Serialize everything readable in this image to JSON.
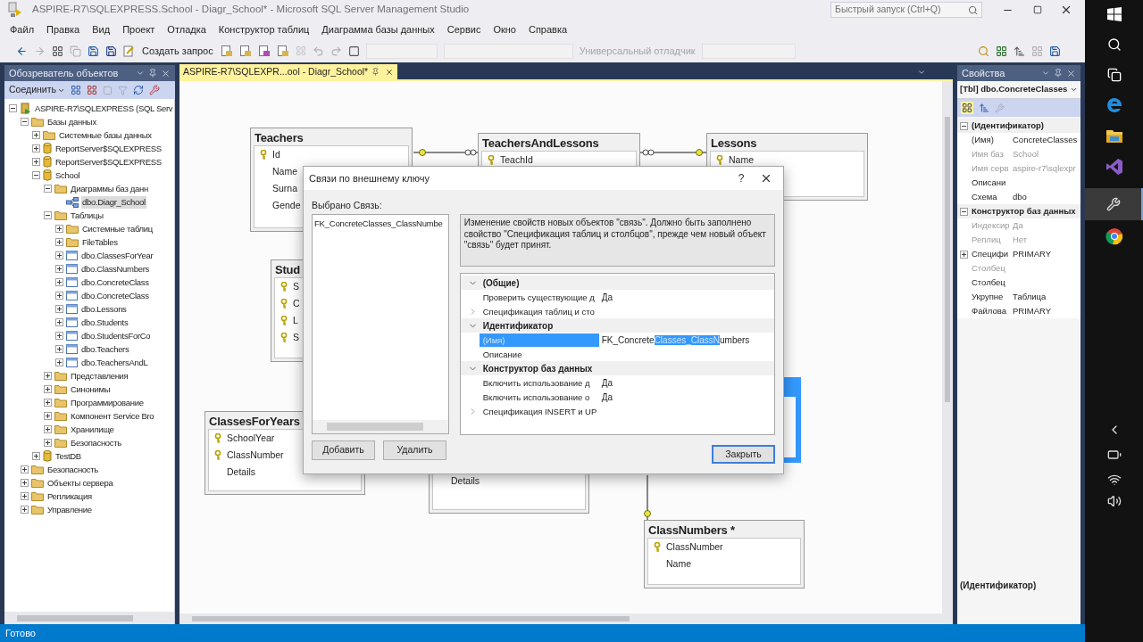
{
  "window": {
    "title": "ASPIRE-R7\\SQLEXPRESS.School - Diagr_School* - Microsoft SQL Server Management Studio"
  },
  "quick_launch": {
    "placeholder": "Быстрый запуск (Ctrl+Q)"
  },
  "menu": [
    "Файл",
    "Правка",
    "Вид",
    "Проект",
    "Отладка",
    "Конструктор таблиц",
    "Диаграмма базы данных",
    "Сервис",
    "Окно",
    "Справка"
  ],
  "toolbar": {
    "new_query": "Создать запрос",
    "debugger": "Универсальный отладчик"
  },
  "object_explorer": {
    "title": "Обозреватель объектов",
    "connect": "Соединить",
    "tree": [
      {
        "label": "ASPIRE-R7\\SQLEXPRESS (SQL Serv",
        "kind": "server",
        "expanded": true,
        "selected": false,
        "children": [
          {
            "label": "Базы данных",
            "kind": "folder",
            "expanded": true,
            "selected": false,
            "children": [
              {
                "label": "Системные базы данных",
                "kind": "folder",
                "expanded": false,
                "selected": false
              },
              {
                "label": "ReportServer$SQLEXPRESS",
                "kind": "database",
                "expanded": false,
                "selected": false
              },
              {
                "label": "ReportServer$SQLEXPRESS",
                "kind": "database",
                "expanded": false,
                "selected": false
              },
              {
                "label": "School",
                "kind": "database",
                "expanded": true,
                "selected": false,
                "children": [
                  {
                    "label": "Диаграммы баз данн",
                    "kind": "folder",
                    "expanded": true,
                    "selected": false,
                    "children": [
                      {
                        "label": "dbo.Diagr_School",
                        "kind": "diagram",
                        "selected": true
                      }
                    ]
                  },
                  {
                    "label": "Таблицы",
                    "kind": "folder",
                    "expanded": true,
                    "selected": false,
                    "children": [
                      {
                        "label": "Системные таблиц",
                        "kind": "folder",
                        "expanded": false,
                        "selected": false
                      },
                      {
                        "label": "FileTables",
                        "kind": "folder",
                        "expanded": false,
                        "selected": false
                      },
                      {
                        "label": "dbo.ClassesForYear",
                        "kind": "table",
                        "expanded": false,
                        "selected": false
                      },
                      {
                        "label": "dbo.ClassNumbers",
                        "kind": "table",
                        "expanded": false,
                        "selected": false
                      },
                      {
                        "label": "dbo.ConcreteClass",
                        "kind": "table",
                        "expanded": false,
                        "selected": false
                      },
                      {
                        "label": "dbo.ConcreteClass",
                        "kind": "table",
                        "expanded": false,
                        "selected": false
                      },
                      {
                        "label": "dbo.Lessons",
                        "kind": "table",
                        "expanded": false,
                        "selected": false
                      },
                      {
                        "label": "dbo.Students",
                        "kind": "table",
                        "expanded": false,
                        "selected": false
                      },
                      {
                        "label": "dbo.StudentsForCo",
                        "kind": "table",
                        "expanded": false,
                        "selected": false
                      },
                      {
                        "label": "dbo.Teachers",
                        "kind": "table",
                        "expanded": false,
                        "selected": false
                      },
                      {
                        "label": "dbo.TeachersAndL",
                        "kind": "table",
                        "expanded": false,
                        "selected": false
                      }
                    ]
                  },
                  {
                    "label": "Представления",
                    "kind": "folder",
                    "expanded": false,
                    "selected": false
                  },
                  {
                    "label": "Синонимы",
                    "kind": "folder",
                    "expanded": false,
                    "selected": false
                  },
                  {
                    "label": "Программирование",
                    "kind": "folder",
                    "expanded": false,
                    "selected": false
                  },
                  {
                    "label": "Компонент Service Bro",
                    "kind": "folder",
                    "expanded": false,
                    "selected": false
                  },
                  {
                    "label": "Хранилище",
                    "kind": "folder",
                    "expanded": false,
                    "selected": false
                  },
                  {
                    "label": "Безопасность",
                    "kind": "folder",
                    "expanded": false,
                    "selected": false
                  }
                ]
              },
              {
                "label": "TestDB",
                "kind": "database",
                "expanded": false,
                "selected": false
              }
            ]
          },
          {
            "label": "Безопасность",
            "kind": "folder",
            "expanded": false,
            "selected": false
          },
          {
            "label": "Объекты сервера",
            "kind": "folder",
            "expanded": false,
            "selected": false
          },
          {
            "label": "Репликация",
            "kind": "folder",
            "expanded": false,
            "selected": false
          },
          {
            "label": "Управление",
            "kind": "folder",
            "expanded": false,
            "selected": false
          }
        ]
      }
    ]
  },
  "document_tab": {
    "title": "ASPIRE-R7\\SQLEXPR...ool - Diagr_School*",
    "selected": true
  },
  "diagram": {
    "tables": [
      {
        "title": "Teachers",
        "selected": false,
        "columns": [
          {
            "name": "Id",
            "key": true
          },
          {
            "name": "Name",
            "key": false
          },
          {
            "name": "Surna",
            "key": false
          },
          {
            "name": "Gende",
            "key": false
          }
        ]
      },
      {
        "title": "TeachersAndLessons",
        "selected": false,
        "columns": [
          {
            "name": "TeachId",
            "key": true
          }
        ]
      },
      {
        "title": "Lessons",
        "selected": false,
        "columns": [
          {
            "name": "Name",
            "key": true
          }
        ]
      },
      {
        "title": "Stud",
        "selected": false,
        "columns": [
          {
            "name": "S",
            "key": true
          },
          {
            "name": "C",
            "key": true
          },
          {
            "name": "L",
            "key": true
          },
          {
            "name": "S",
            "key": true
          }
        ]
      },
      {
        "title": "ClassesForYears",
        "selected": false,
        "columns": [
          {
            "name": "SchoolYear",
            "key": true
          },
          {
            "name": "ClassNumber",
            "key": true
          },
          {
            "name": "Details",
            "key": false
          }
        ]
      },
      {
        "selected": false,
        "columns": [
          {
            "name": "Details",
            "key": false
          }
        ]
      },
      {
        "selected": true
      },
      {
        "title": "ClassNumbers *",
        "selected": false,
        "columns": [
          {
            "name": "ClassNumber",
            "key": true
          },
          {
            "name": "Name",
            "key": false
          }
        ]
      }
    ]
  },
  "properties": {
    "title": "Свойства",
    "object": "[Tbl] dbo.ConcreteClasses",
    "rows": [
      {
        "kind": "group",
        "name": "(Идентификатор)",
        "expanded": true
      },
      {
        "kind": "property",
        "name": "(Имя)",
        "value": "ConcreteClasses",
        "disabled": false
      },
      {
        "kind": "property",
        "name": "Имя баз",
        "value": "School",
        "disabled": true
      },
      {
        "kind": "property",
        "name": "Имя серв",
        "value": "aspire-r7\\sqlexpr",
        "disabled": true
      },
      {
        "kind": "property",
        "name": "Описани",
        "disabled": false
      },
      {
        "kind": "property",
        "name": "Схема",
        "value": "dbo",
        "disabled": false
      },
      {
        "kind": "group",
        "name": "Конструктор баз данных",
        "expanded": true
      },
      {
        "kind": "property",
        "name": "Индексир",
        "value": "Да",
        "disabled": true
      },
      {
        "kind": "property",
        "name": "Реплиц",
        "value": "Нет",
        "disabled": true
      },
      {
        "kind": "property",
        "name": "Специфи",
        "value": "PRIMARY",
        "disabled": false,
        "expanded": false
      },
      {
        "kind": "property",
        "name": "Столбец",
        "disabled": true
      },
      {
        "kind": "property",
        "name": "Столбец",
        "disabled": false
      },
      {
        "kind": "property",
        "name": "Укрупне",
        "value": "Таблица",
        "disabled": false
      },
      {
        "kind": "property",
        "name": "Файлова",
        "value": "PRIMARY",
        "disabled": false
      }
    ],
    "description_title": "(Идентификатор)"
  },
  "dialog": {
    "title": "Связи по внешнему ключу",
    "help": "?",
    "list_label": "Выбрано Связь:",
    "relationships": [
      "FK_ConcreteClasses_ClassNumbe"
    ],
    "buttons": [
      "Добавить",
      "Удалить"
    ],
    "description": "Изменение свойств новых объектов \"связь\". Должно быть заполнено свойство \"Спецификация таблиц и столбцов\", прежде чем новый объект \"связь\" будет принят.",
    "grid": [
      {
        "kind": "category",
        "name": "(Общие)",
        "expanded": true,
        "selected": false
      },
      {
        "kind": "property",
        "name": "Проверить существующие д",
        "value": "Да",
        "selected": false
      },
      {
        "kind": "property",
        "name": "Спецификация таблиц и сто",
        "expanded": false,
        "selected": false
      },
      {
        "kind": "category",
        "name": "Идентификатор",
        "expanded": true,
        "selected": false
      },
      {
        "kind": "property",
        "name": "(Имя)",
        "value": "FK_Concrete",
        "value_selected": "Classes_ClassN",
        "value_after": "umbers",
        "selected": true
      },
      {
        "kind": "property",
        "name": "Описание",
        "selected": false
      },
      {
        "kind": "category",
        "name": "Конструктор баз данных",
        "expanded": true,
        "selected": false
      },
      {
        "kind": "property",
        "name": "Включить использование д",
        "value": "Да",
        "selected": false
      },
      {
        "kind": "property",
        "name": "Включить использование о",
        "value": "Да",
        "selected": false
      },
      {
        "kind": "property",
        "name": "Спецификация INSERT и UP",
        "expanded": false,
        "selected": false
      }
    ],
    "close": "Закрыть"
  },
  "status_bar": "Готово"
}
